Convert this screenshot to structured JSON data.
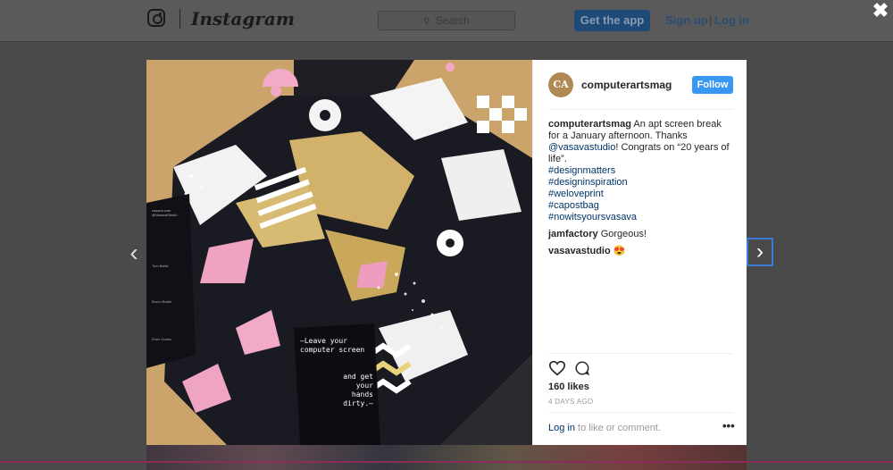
{
  "topbar": {
    "brand": "Instagram",
    "search_placeholder": "Search",
    "get_app": "Get the app",
    "sign_up": "Sign up",
    "separator": "|",
    "log_in": "Log in"
  },
  "modal": {
    "close_icon": "close-icon",
    "prev_icon": "chevron-left-icon",
    "next_icon": "chevron-right-icon"
  },
  "photo": {
    "card_text_1": "—Leave your computer screen",
    "card_text_2": "and get your hands dirty.—",
    "small_caption": "vasava.com @VasavaStudio",
    "sig1": "Tom Batist",
    "sig2": "Bruno Batist",
    "sig3": "Enric Godko"
  },
  "post": {
    "avatar_text": "CA",
    "username": "computerartsmag",
    "follow": "Follow",
    "caption": {
      "user": "computerartsmag",
      "text_before": " An apt screen break for a January afternoon. Thanks ",
      "mention": "@vasavastudio",
      "text_after": "! Congrats on “20 years of life”.",
      "hashtags": [
        "#designmatters",
        "#designinspiration",
        "#weloveprint",
        "#capostbag",
        "#nowitsyoursvasava"
      ]
    },
    "comments": [
      {
        "user": "jamfactory",
        "text": " Gorgeous!"
      },
      {
        "user": "vasavastudio",
        "text": " 😍"
      }
    ],
    "likes": "160 likes",
    "time_ago": "4 DAYS AGO",
    "login_link": "Log in",
    "login_rest": " to like or comment.",
    "more": "•••"
  },
  "colors": {
    "follow_bg": "#3897f0",
    "link": "#003569",
    "overlay": "#4a4a4a"
  }
}
